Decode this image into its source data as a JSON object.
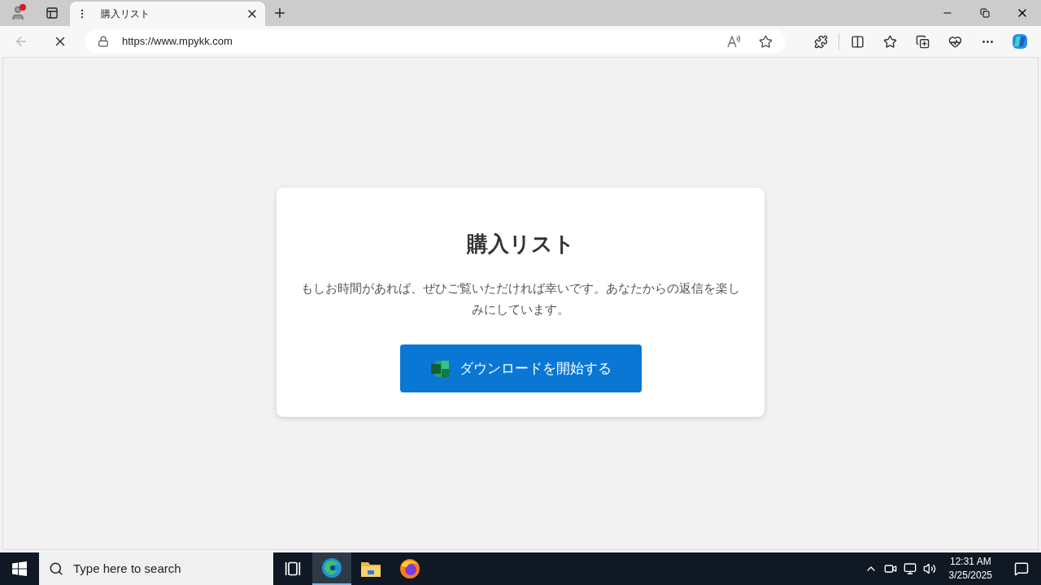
{
  "browser": {
    "tab": {
      "title": "購入リスト"
    },
    "address": {
      "url": "https://www.mpykk.com"
    }
  },
  "page": {
    "title": "購入リスト",
    "message": "もしお時間があれば、ぜひご覧いただければ幸いです。あなたからの返信を楽しみにしています。",
    "button": "ダウンロードを開始する"
  },
  "taskbar": {
    "search": {
      "placeholder": "Type here to search"
    },
    "apps": [
      {
        "kind": "edge",
        "selected": true
      },
      {
        "kind": "explorer",
        "selected": false
      },
      {
        "kind": "firefox",
        "selected": false
      }
    ],
    "clock": {
      "time": "12:31 AM",
      "date": "3/25/2025"
    }
  }
}
